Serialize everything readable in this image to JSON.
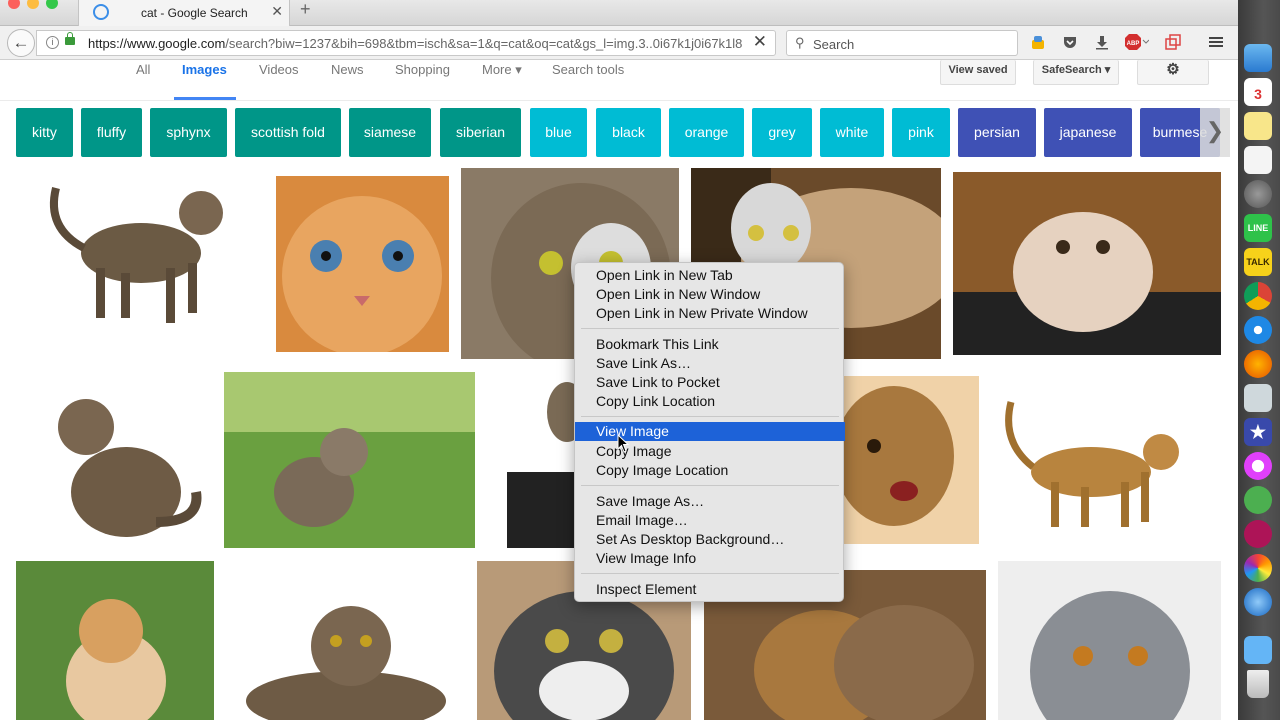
{
  "browser": {
    "tab_title": "cat - Google Search",
    "new_tab": "+",
    "tab_close": "✕",
    "back": "←",
    "url_domain": "https://www.google.com",
    "url_rest": "/search?biw=1237&bih=698&tbm=isch&sa=1&q=cat&oq=cat&gs_l=img.3..0i67k1j0i67k1l8",
    "url_clear": "✕",
    "search_placeholder": "Search",
    "abp_label": "ABP"
  },
  "google": {
    "tabs": [
      "All",
      "Images",
      "Videos",
      "News",
      "Shopping",
      "More ▾",
      "Search tools"
    ],
    "active_tab": "Images",
    "view_saved": "View saved",
    "safesearch": "SafeSearch ▾",
    "chips": [
      {
        "label": "kitty",
        "color": "#009688"
      },
      {
        "label": "fluffy",
        "color": "#009688"
      },
      {
        "label": "sphynx",
        "color": "#009688"
      },
      {
        "label": "scottish fold",
        "color": "#009688"
      },
      {
        "label": "siamese",
        "color": "#009688"
      },
      {
        "label": "siberian",
        "color": "#009688"
      },
      {
        "label": "blue",
        "color": "#00bcd4"
      },
      {
        "label": "black",
        "color": "#00bcd4"
      },
      {
        "label": "orange",
        "color": "#00bcd4"
      },
      {
        "label": "grey",
        "color": "#00bcd4"
      },
      {
        "label": "white",
        "color": "#00bcd4"
      },
      {
        "label": "pink",
        "color": "#00bcd4"
      },
      {
        "label": "persian",
        "color": "#3f51b5"
      },
      {
        "label": "japanese",
        "color": "#3f51b5"
      },
      {
        "label": "burmese",
        "color": "#3f51b5"
      }
    ],
    "chip_next": "❯"
  },
  "context_menu": {
    "items": [
      "Open Link in New Tab",
      "Open Link in New Window",
      "Open Link in New Private Window",
      "Bookmark This Link",
      "Save Link As…",
      "Save Link to Pocket",
      "Copy Link Location",
      "View Image",
      "Copy Image",
      "Copy Image Location",
      "Save Image As…",
      "Email Image…",
      "Set As Desktop Background…",
      "View Image Info",
      "Inspect Element"
    ],
    "highlighted": "View Image"
  },
  "dock": {
    "calendar_day": "3",
    "line_label": "LINE",
    "talk_label": "TALK"
  },
  "colors": {
    "teal": "#009688",
    "cyan": "#00bcd4",
    "indigo": "#3f51b5",
    "highlight": "#1d62d8",
    "google_blue": "#4285f4"
  }
}
